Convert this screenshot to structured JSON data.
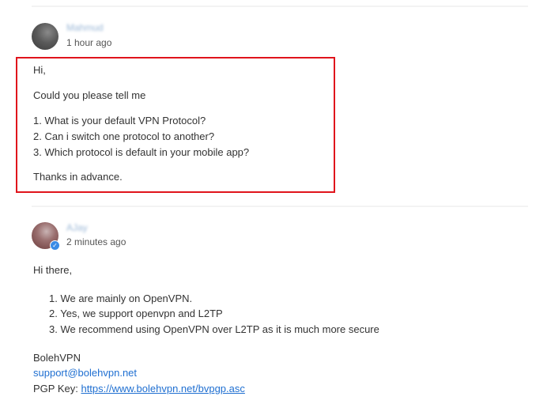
{
  "messages": [
    {
      "author": "Mahmud",
      "time": "1 hour ago",
      "greeting": "Hi,",
      "question": "Could you please tell me",
      "items": [
        "1. What is your default VPN Protocol?",
        "2. Can i switch one protocol to another?",
        "3. Which protocol is default in your mobile app?"
      ],
      "closing": "Thanks in advance."
    },
    {
      "author": "AJay",
      "time": "2 minutes ago",
      "greeting": "Hi there,",
      "items": [
        "1. We are mainly on OpenVPN.",
        "2. Yes, we support openvpn and L2TP",
        "3. We recommend using OpenVPN over L2TP as it is much more secure"
      ],
      "signature": {
        "name": "BolehVPN",
        "email": "support@bolehvpn.net",
        "pgp_label": "PGP Key: ",
        "pgp_url": "https://www.bolehvpn.net/bvpgp.asc"
      }
    }
  ],
  "colors": {
    "highlight_border": "#e0141c",
    "link": "#1f6fd1",
    "verified_badge": "#3a8be6"
  },
  "icons": {
    "verified": "verified-check-icon"
  }
}
